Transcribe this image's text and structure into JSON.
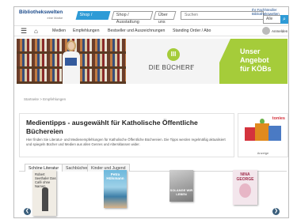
{
  "header": {
    "logo": "Bibliothekswelten",
    "logo_sub": "eine Marke",
    "tabs": [
      "Shop / Medien",
      "Shop / Ausstattung",
      "Über uns"
    ],
    "search_placeholder": "Suchen",
    "search_scope": "Alle",
    "util_link": "Ihr Fachhändler Bibliothekswelten"
  },
  "nav": {
    "items": [
      "Medien",
      "Empfehlungen",
      "Bestseller und Auszeichnungen",
      "Standing Order / Abo"
    ],
    "user_label": "Anmelden"
  },
  "banner": {
    "logo_text": "DIE BÜCHEREI",
    "headline_1": "Unser Angebot",
    "headline_2": "für KÖBs"
  },
  "breadcrumb": "Startseite > Empfehlungen",
  "content": {
    "title": "Medientipps - ausgewählt für Katholische Öffentliche Büchereien",
    "body": "Hier finden Sie Literatur- und Medienempfehlungen für Katholische Öffentliche Büchereien. Die Tipps werden regelmäßig aktualisiert und spiegeln Bücher und Medien aus allen Genres und Altersklassen wider."
  },
  "ad": {
    "brand": "tonies",
    "caption": "Anzeige"
  },
  "tabs": [
    "Schöne Literatur",
    "Sachbücher",
    "Kinder und Jugend"
  ],
  "books": [
    {
      "title": "Robert Seethaler Das Café ohne Namen"
    },
    {
      "title": "Petra Hülsmann"
    },
    {
      "title": "SOLANGE WIR LEBEN"
    },
    {
      "title": "NINA GEORGE"
    }
  ]
}
